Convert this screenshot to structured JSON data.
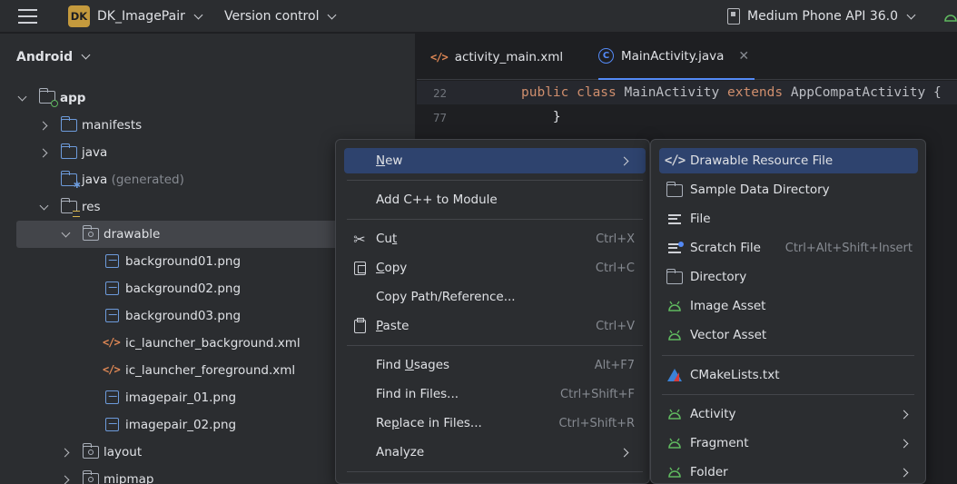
{
  "titlebar": {
    "project_badge": "DK",
    "project_name": "DK_ImagePair",
    "vcs_label": "Version control",
    "device_name": "Medium Phone API 36.0"
  },
  "project_panel": {
    "view_selector": "Android",
    "tree": [
      {
        "label": "app",
        "expanded": true
      },
      {
        "label": "manifests",
        "expanded": false
      },
      {
        "label": "java",
        "expanded": false
      },
      {
        "label": "java",
        "suffix": "(generated)"
      },
      {
        "label": "res",
        "expanded": true
      },
      {
        "label": "drawable",
        "expanded": true,
        "selected": true
      },
      {
        "label": "background01.png"
      },
      {
        "label": "background02.png"
      },
      {
        "label": "background03.png"
      },
      {
        "label": "ic_launcher_background.xml"
      },
      {
        "label": "ic_launcher_foreground.xml"
      },
      {
        "label": "imagepair_01.png"
      },
      {
        "label": "imagepair_02.png"
      },
      {
        "label": "layout",
        "expanded": false
      },
      {
        "label": "mipmap",
        "expanded": false
      }
    ]
  },
  "editor": {
    "tabs": [
      {
        "label": "activity_main.xml",
        "icon": "xml-icon"
      },
      {
        "label": "MainActivity.java",
        "icon": "java-class-icon",
        "active": true
      }
    ],
    "lines": [
      {
        "num": "22",
        "kw1": "public class ",
        "name": "MainActivity ",
        "kw2": "extends ",
        "parent": "AppCompatActivity {"
      },
      {
        "num": "77",
        "text": "    }"
      }
    ]
  },
  "context_menu": {
    "items": [
      {
        "label": "New",
        "mnemonic_index": 0,
        "submenu": true,
        "active": true
      },
      {
        "label": "Add C++ to Module"
      },
      {
        "label": "Cut",
        "shortcut": "Ctrl+X",
        "icon": "scissors-icon"
      },
      {
        "label": "Copy",
        "shortcut": "Ctrl+C",
        "icon": "copy-icon"
      },
      {
        "label": "Copy Path/Reference..."
      },
      {
        "label": "Paste",
        "shortcut": "Ctrl+V",
        "icon": "paste-icon"
      },
      {
        "label": "Find Usages",
        "shortcut": "Alt+F7"
      },
      {
        "label": "Find in Files...",
        "shortcut": "Ctrl+Shift+F"
      },
      {
        "label": "Replace in Files...",
        "shortcut": "Ctrl+Shift+R"
      },
      {
        "label": "Analyze",
        "submenu": true
      }
    ]
  },
  "new_submenu": {
    "items": [
      {
        "label": "Drawable Resource File",
        "icon": "xml-icon",
        "active": true
      },
      {
        "label": "Sample Data Directory",
        "icon": "folder-icon"
      },
      {
        "label": "File",
        "icon": "file-lines-icon"
      },
      {
        "label": "Scratch File",
        "shortcut": "Ctrl+Alt+Shift+Insert",
        "icon": "scratch-file-icon"
      },
      {
        "label": "Directory",
        "icon": "folder-icon"
      },
      {
        "label": "Image Asset",
        "icon": "android-icon"
      },
      {
        "label": "Vector Asset",
        "icon": "android-icon"
      },
      {
        "label": "CMakeLists.txt",
        "icon": "cmake-icon"
      },
      {
        "label": "Activity",
        "icon": "android-icon",
        "submenu": true
      },
      {
        "label": "Fragment",
        "icon": "android-icon",
        "submenu": true
      },
      {
        "label": "Folder",
        "icon": "android-icon",
        "submenu": true
      }
    ]
  },
  "colors": {
    "accent": "#548af7",
    "menu_highlight": "#2e436e",
    "keyword": "#cf8e6d",
    "android_green": "#5fb85f",
    "xml_orange": "#e08855"
  }
}
